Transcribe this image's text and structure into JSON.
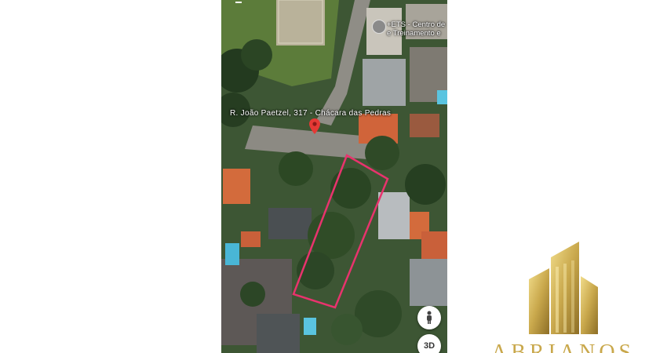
{
  "map": {
    "street_label": "R. João Paetzel, 317 - Chácara das Pedras",
    "poi_label_line1": "+ETS - Centro de",
    "poi_label_line2": "e Treinamento e",
    "controls": {
      "pegman": "pegman-icon",
      "view_3d": "3D"
    }
  },
  "colors": {
    "boundary": "#e8336d",
    "pin": "#e53935",
    "brand_gold": "#c9a84c"
  },
  "brand": {
    "name": "ABRIANOS"
  }
}
